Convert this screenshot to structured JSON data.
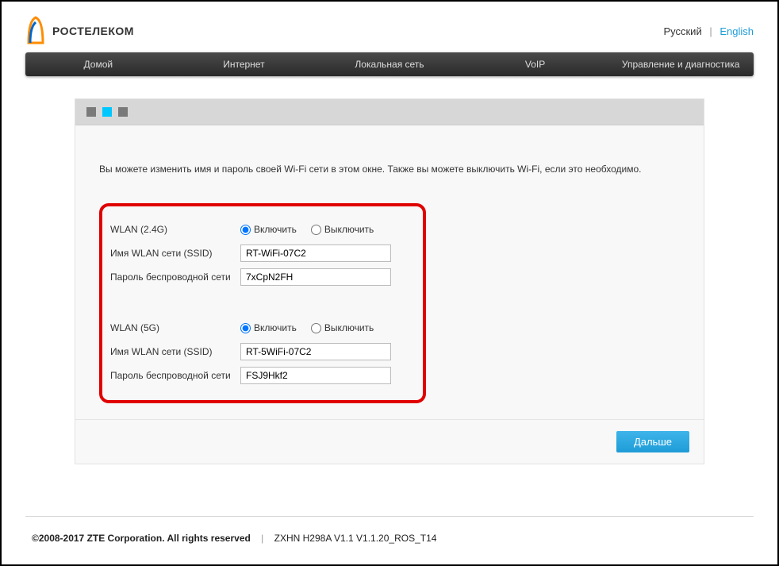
{
  "brand": "РОСТЕЛЕКОМ",
  "lang": {
    "ru": "Русский",
    "en": "English"
  },
  "nav": {
    "home": "Домой",
    "internet": "Интернет",
    "lan": "Локальная сеть",
    "voip": "VoIP",
    "mgmt": "Управление и диагностика"
  },
  "intro": "Вы можете изменить имя и пароль своей Wi-Fi сети в этом окне. Также вы можете выключить Wi-Fi, если это необходимо.",
  "labels": {
    "wlan24": "WLAN (2.4G)",
    "wlan5": "WLAN (5G)",
    "ssid": "Имя WLAN сети (SSID)",
    "password": "Пароль беспроводной сети",
    "enable": "Включить",
    "disable": "Выключить"
  },
  "wlan24": {
    "enabled": true,
    "ssid": "RT-WiFi-07C2",
    "password": "7xCpN2FH"
  },
  "wlan5": {
    "enabled": true,
    "ssid": "RT-5WiFi-07C2",
    "password": "FSJ9Hkf2"
  },
  "buttons": {
    "next": "Дальше"
  },
  "footer": {
    "copyright": "©2008-2017 ZTE Corporation. All rights reserved",
    "model": "ZXHN H298A V1.1 V1.1.20_ROS_T14"
  }
}
